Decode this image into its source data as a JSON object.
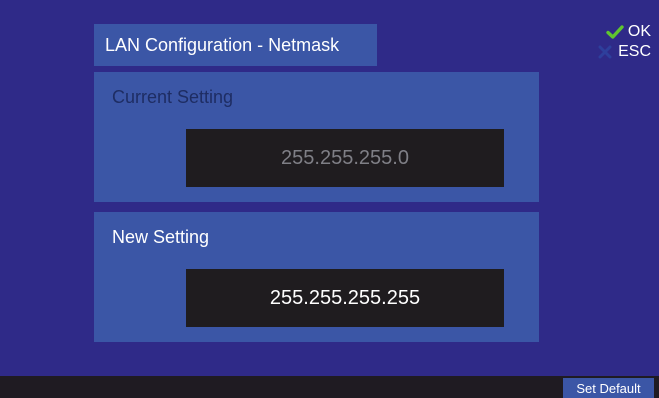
{
  "header": {
    "title": "LAN Configuration - Netmask"
  },
  "soft_keys": {
    "ok": {
      "label": "OK",
      "icon": "check-icon",
      "color": "#5fc62f"
    },
    "esc": {
      "label": "ESC",
      "icon": "close-icon",
      "color": "#2e3f9c"
    }
  },
  "current_setting": {
    "label": "Current Setting",
    "value": "255.255.255.0"
  },
  "new_setting": {
    "label": "New Setting",
    "value": "255.255.255.255"
  },
  "footer": {
    "set_default_label": "Set Default"
  },
  "colors": {
    "background": "#2f2a88",
    "panel": "#3b56a6",
    "field": "#1f1c1f",
    "footer": "#1f1b22"
  }
}
